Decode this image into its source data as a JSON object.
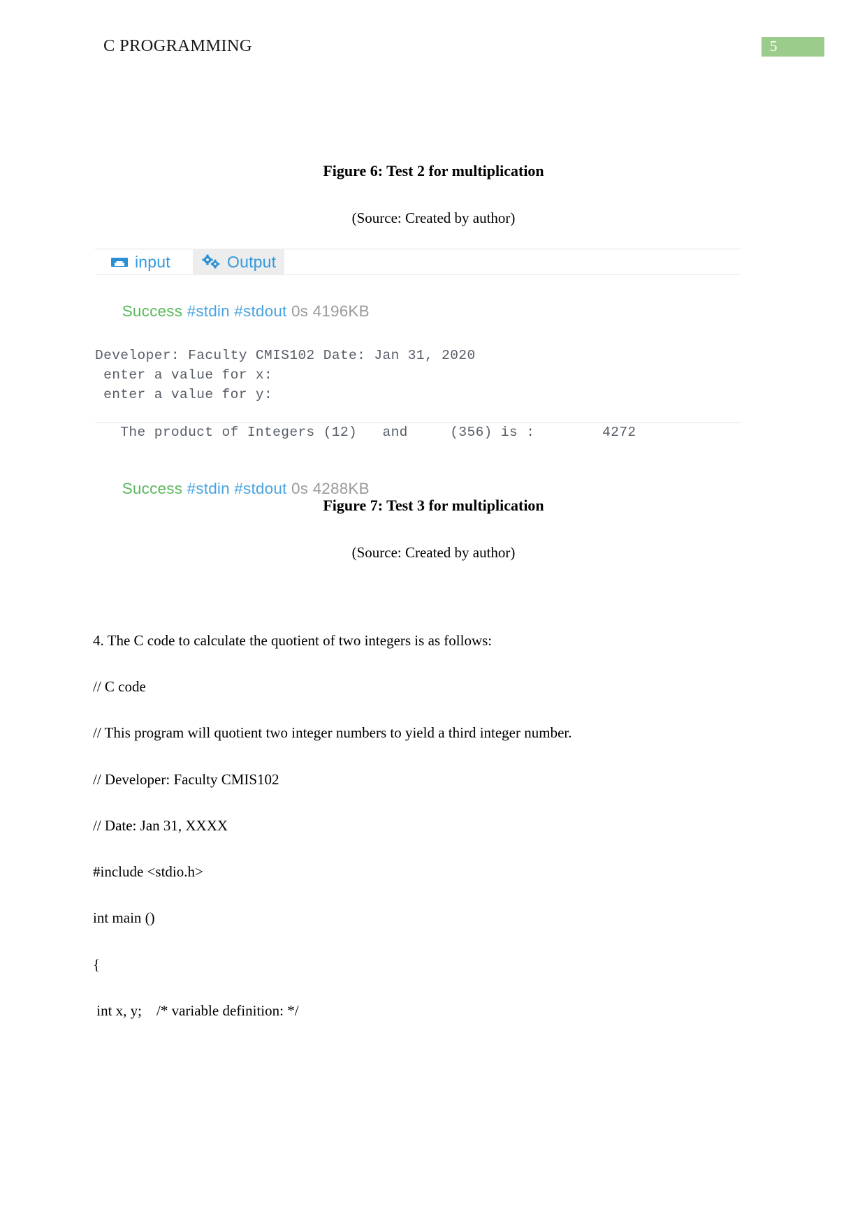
{
  "header": {
    "title": "C PROGRAMMING",
    "page_number": "5",
    "badge_color": "#9ccc8c"
  },
  "captions": {
    "figure6_title": "Figure 6: Test 2 for multiplication",
    "figure6_source": "(Source: Created by author)",
    "figure7_title": "Figure 7: Test 3 for multiplication",
    "figure7_source": "(Source: Created by author)"
  },
  "output_figure": {
    "tabs": [
      {
        "label": "input",
        "icon": "inbox-tray-icon",
        "active": false
      },
      {
        "label": "Output",
        "icon": "gears-icon",
        "active": true
      }
    ],
    "status_top": {
      "success": "Success",
      "streams": "#stdin #stdout",
      "meta": "0s 4196KB"
    },
    "status_bottom": {
      "success": "Success",
      "streams": "#stdin #stdout",
      "meta": "0s 4288KB"
    },
    "console_lines": [
      "Developer: Faculty CMIS102 Date: Jan 31, 2020",
      " enter a value for x:",
      " enter a value for y:",
      "",
      "   The product of Integers (12)   and     (356) is :        4272"
    ]
  },
  "body": {
    "lines": [
      "4. The C code to calculate the quotient of two integers is as follows:",
      "// C code",
      "// This program will quotient two integer numbers to yield a third integer number.",
      "// Developer: Faculty CMIS102",
      "// Date: Jan 31, XXXX",
      "#include <stdio.h>",
      "int main ()",
      "{",
      " int x, y;    /* variable definition: */"
    ]
  },
  "colors": {
    "success_green": "#5cb85c",
    "stream_blue": "#4aa3df",
    "meta_gray": "#9a9a9a",
    "tab_blue": "#3399dd"
  }
}
